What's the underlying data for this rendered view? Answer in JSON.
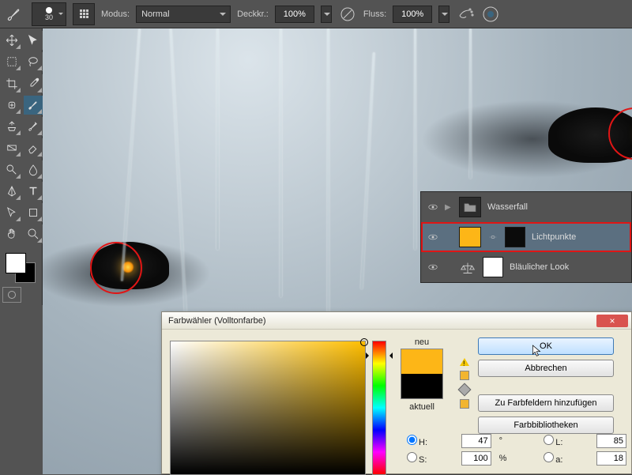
{
  "optbar": {
    "brush_size": "30",
    "mode_label": "Modus:",
    "mode_value": "Normal",
    "opacity_label": "Deckkr.:",
    "opacity_value": "100%",
    "flow_label": "Fluss:",
    "flow_value": "100%"
  },
  "layers": {
    "items": [
      {
        "name": "Wasserfall",
        "type": "group"
      },
      {
        "name": "Lichtpunkte",
        "type": "fill",
        "swatch": "#fdb617",
        "mask": "black",
        "selected": true,
        "highlight": true
      },
      {
        "name": "Bläulicher Look",
        "type": "adjustment",
        "mask": "white"
      }
    ]
  },
  "dialog": {
    "title": "Farbwähler (Volltonfarbe)",
    "new_label": "neu",
    "current_label": "aktuell",
    "btn_ok": "OK",
    "btn_cancel": "Abbrechen",
    "btn_add": "Zu Farbfeldern hinzufügen",
    "btn_lib": "Farbbibliotheken",
    "fields": {
      "H_label": "H:",
      "H_value": "47",
      "H_unit": "°",
      "S_label": "S:",
      "S_value": "100",
      "S_unit": "%",
      "L_label": "L:",
      "L_value": "85",
      "a_label": "a:",
      "a_value": "18"
    },
    "colors": {
      "new": "#fdb617",
      "current": "#000000",
      "hue_deg": 47
    }
  }
}
